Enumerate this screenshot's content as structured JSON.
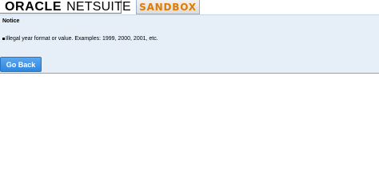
{
  "header": {
    "logo": {
      "oracle": "ORACLE",
      "netsuite": "NETSUITE"
    },
    "environment_badge": "SANDBOX",
    "environment_color": "#e07b00"
  },
  "notice": {
    "title": "Notice",
    "message": "Illegal year format or value. Examples: 1999, 2000, 2001, etc."
  },
  "actions": {
    "go_back_label": "Go Back"
  },
  "colors": {
    "panel_background": "#e6eff8",
    "button_primary": "#2f86e0"
  }
}
